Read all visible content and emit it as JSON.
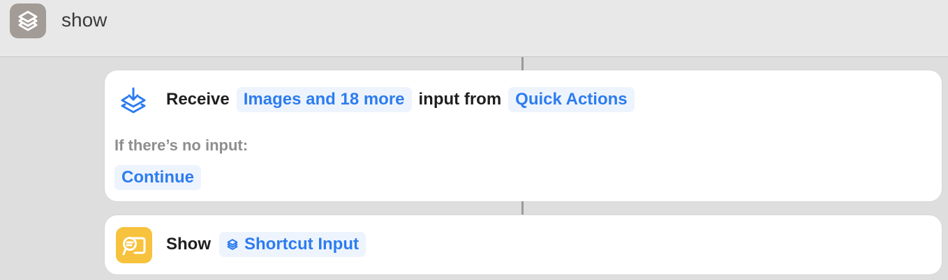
{
  "window": {
    "title": "show",
    "app_icon": "shortcuts-icon"
  },
  "actions": [
    {
      "icon": "receive-input-icon",
      "verb": "Receive",
      "types_token": "Images and 18 more",
      "connector_text": "input from",
      "source_token": "Quick Actions",
      "no_input_label": "If there’s no input:",
      "no_input_value": "Continue"
    },
    {
      "icon": "show-result-icon",
      "verb": "Show",
      "variable_icon": "shortcuts-variable-icon",
      "variable_token": "Shortcut Input"
    }
  ],
  "colors": {
    "accent": "#2c7cf0",
    "token_bg": "#eef4fd",
    "show_icon_bg": "#f7c23d",
    "app_icon_bg": "#a39b96"
  }
}
